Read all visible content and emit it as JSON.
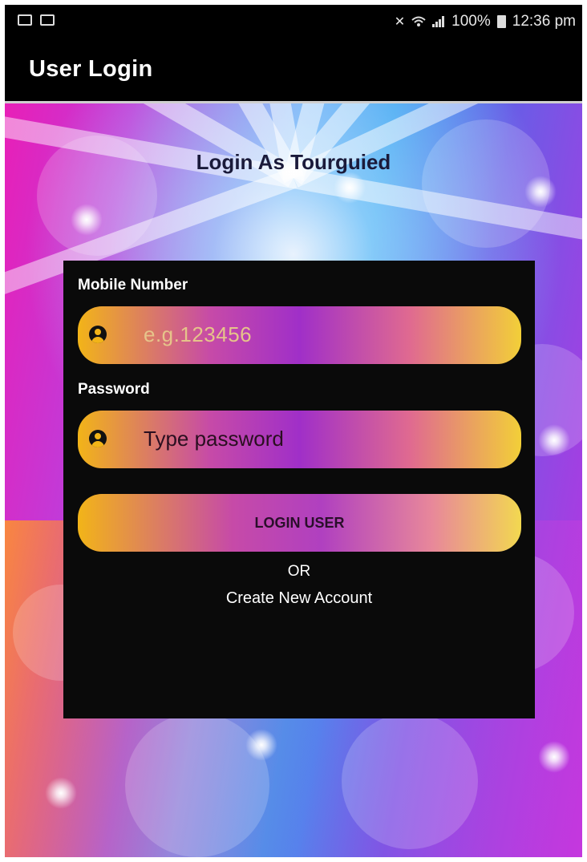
{
  "status_bar": {
    "battery": "100%",
    "time": "12:36 pm"
  },
  "app_bar": {
    "title": "User Login"
  },
  "screen": {
    "heading": "Login As Tourguied"
  },
  "form": {
    "mobile_label": "Mobile Number",
    "mobile_placeholder": "e.g.123456",
    "password_label": "Password",
    "password_placeholder": "Type password",
    "login_button": "LOGIN USER",
    "or_text": "OR",
    "create_account": "Create New Account"
  },
  "icons": {
    "field_icon": "user-circle-icon"
  },
  "colors": {
    "gradient_start": "#f2b418",
    "gradient_mid": "#a02fc8",
    "gradient_end": "#f2cf38",
    "card_background": "#0a0a0a"
  }
}
